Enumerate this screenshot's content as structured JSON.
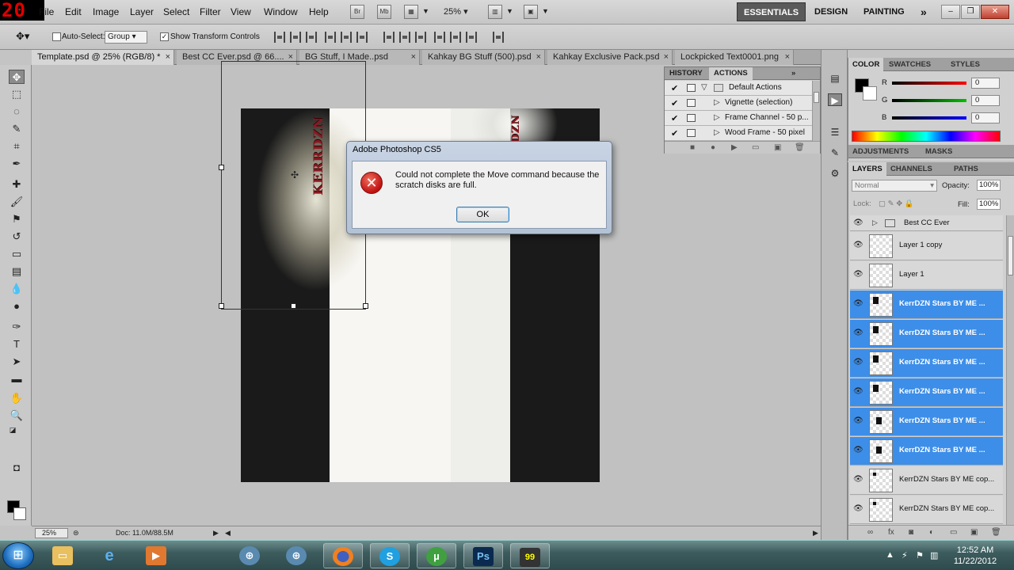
{
  "overlay_counter": "20",
  "menu": {
    "items": [
      "File",
      "Edit",
      "Image",
      "Layer",
      "Select",
      "Filter",
      "View",
      "Window",
      "Help"
    ],
    "icon_br": "Br",
    "icon_mb": "Mb",
    "zoom": "25%",
    "workspaces": [
      "ESSENTIALS",
      "DESIGN",
      "PAINTING"
    ],
    "more": "»"
  },
  "options": {
    "auto_select_label": "Auto-Select:",
    "auto_select_value": "Group",
    "show_transform_label": "Show Transform Controls",
    "show_transform_checked": "✓"
  },
  "tabs": [
    {
      "label": "Template.psd @ 25% (RGB/8) *"
    },
    {
      "label": "Best CC Ever.psd @ 66...."
    },
    {
      "label": "BG Stuff, I Made..psd"
    },
    {
      "label": "Kahkay BG Stuff (500).psd"
    },
    {
      "label": "Kahkay Exclusive Pack.psd"
    },
    {
      "label": "Lockpicked Text0001.png"
    }
  ],
  "canvas_text": {
    "left": "KERRDZN",
    "right": "KERRDZN"
  },
  "dialog": {
    "title": "Adobe Photoshop CS5",
    "message": "Could not complete the Move command because the scratch disks are full.",
    "ok_label": "OK"
  },
  "status": {
    "zoom": "25%",
    "doc": "Doc: 11.0M/88.5M"
  },
  "history_panel": {
    "tabs": [
      "HISTORY",
      "ACTIONS"
    ],
    "more": "»",
    "rows": [
      {
        "label": "Default Actions",
        "expanded": true
      },
      {
        "label": "Vignette (selection)"
      },
      {
        "label": "Frame Channel - 50 p..."
      },
      {
        "label": "Wood Frame - 50 pixel"
      }
    ]
  },
  "color_panel": {
    "tabs": [
      "COLOR",
      "SWATCHES",
      "STYLES"
    ],
    "r_label": "R",
    "g_label": "G",
    "b_label": "B",
    "r": "0",
    "g": "0",
    "b": "0",
    "slider_colors": {
      "r": "#ff0000",
      "g": "#00c000",
      "b": "#0000ff"
    }
  },
  "adjustments_panel": {
    "tabs": [
      "ADJUSTMENTS",
      "MASKS"
    ]
  },
  "layers_panel": {
    "tabs": [
      "LAYERS",
      "CHANNELS",
      "PATHS"
    ],
    "blend_mode": "Normal",
    "opacity_label": "Opacity:",
    "opacity": "100%",
    "lock_label": "Lock:",
    "fill_label": "Fill:",
    "fill": "100%",
    "group": {
      "name": "Best CC Ever"
    },
    "layers": [
      {
        "name": "Layer 1 copy",
        "selected": false
      },
      {
        "name": "Layer 1",
        "selected": false
      },
      {
        "name": "KerrDZN Stars BY ME ...",
        "selected": true
      },
      {
        "name": "KerrDZN Stars BY ME ...",
        "selected": true
      },
      {
        "name": "KerrDZN Stars BY ME ...",
        "selected": true
      },
      {
        "name": "KerrDZN Stars BY ME ...",
        "selected": true
      },
      {
        "name": "KerrDZN Stars BY ME ...",
        "selected": true
      },
      {
        "name": "KerrDZN Stars BY ME ...",
        "selected": true
      },
      {
        "name": "KerrDZN Stars BY ME cop...",
        "selected": false
      },
      {
        "name": "KerrDZN Stars BY ME cop...",
        "selected": false
      }
    ]
  },
  "taskbar": {
    "apps": [
      "start",
      "explorer",
      "internet-explorer",
      "media-player",
      "chrome",
      "network",
      "network-2",
      "firefox",
      "skype",
      "utorrent",
      "photoshop",
      "counter-app"
    ],
    "photoshop_label": "Ps",
    "counter_label": "99",
    "time": "12:52 AM",
    "date": "11/22/2012"
  },
  "colors": {
    "selection_blue": "#3d8ee8",
    "accent_red": "#c01010",
    "taskbar": "#3d5c5e"
  }
}
